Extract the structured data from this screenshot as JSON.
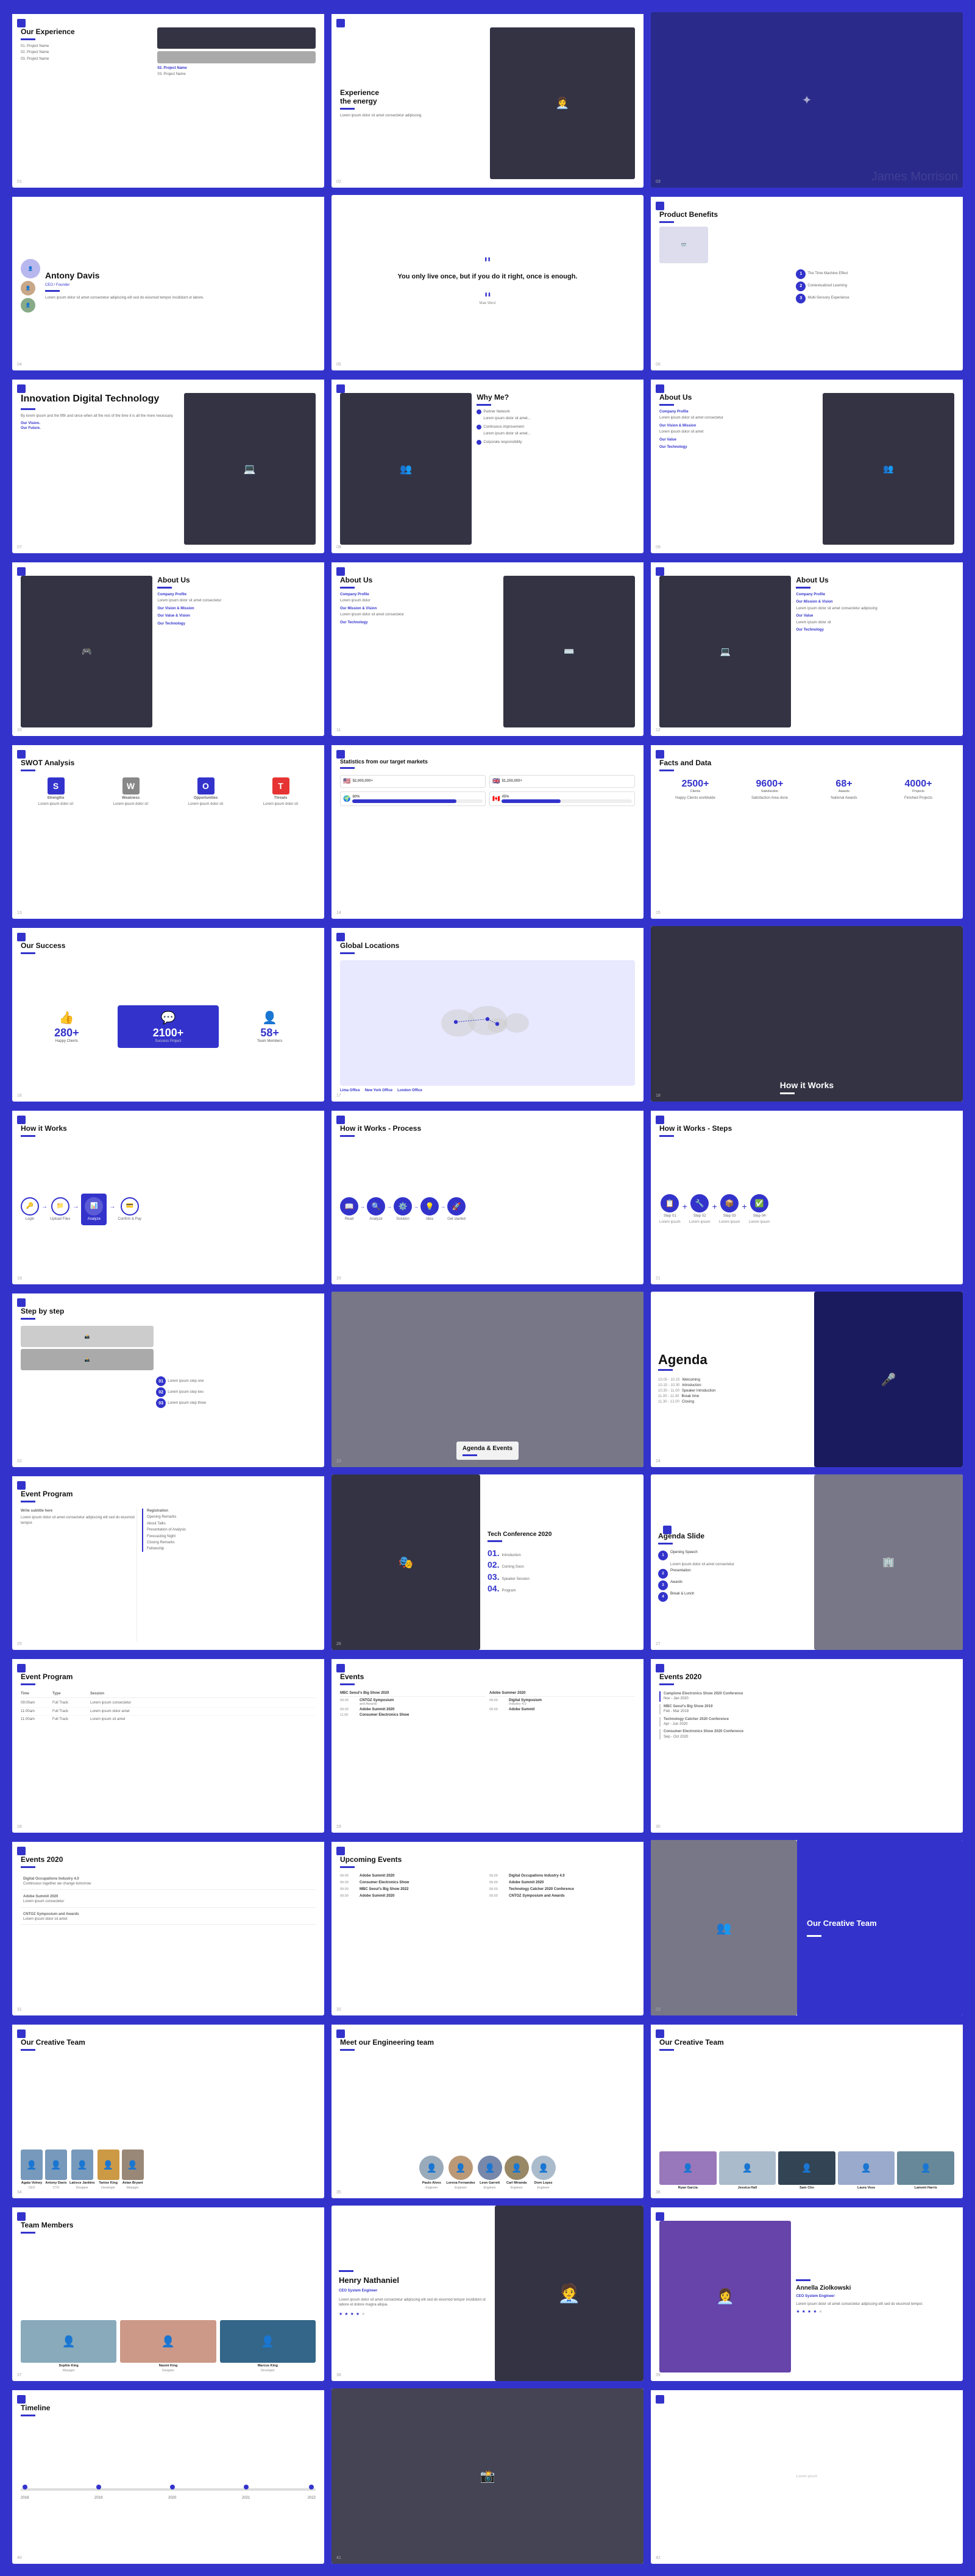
{
  "slides": [
    {
      "id": 1,
      "type": "experience",
      "title": "Our Experience",
      "subtitle": "01. Project Name",
      "items": [
        "02. Project Name",
        "03. Project Name"
      ],
      "number": "01"
    },
    {
      "id": 2,
      "type": "experience2",
      "title": "Experience the energy",
      "number": "02"
    },
    {
      "id": 3,
      "type": "dark-solid",
      "title": "",
      "number": "03"
    },
    {
      "id": 4,
      "type": "team-member",
      "name": "Antony Davis",
      "role": "CEO / Founder",
      "number": "04"
    },
    {
      "id": 5,
      "type": "quote",
      "quote": "You only live once, but if you do it right, once is enough.",
      "author": "Mae West",
      "number": "05"
    },
    {
      "id": 6,
      "type": "product-benefits",
      "title": "Product Benefits",
      "benefits": [
        "The Time Machine Effect",
        "Contextualized Learning",
        "Multi-Sensory Experience"
      ],
      "number": "06"
    },
    {
      "id": 7,
      "type": "innovation",
      "title": "Innovation Digital Technology",
      "body": "By lorem ipsum and the fifth and since when all the rest of the time it is all the more necessary to be done. Our Vision. Our Future.",
      "number": "07"
    },
    {
      "id": 8,
      "type": "why-me",
      "title": "Why Me?",
      "items": [
        "Partner Network",
        "Continuous improvement",
        "Corporate responsibility"
      ],
      "number": "08"
    },
    {
      "id": 9,
      "type": "about-us-right-photo",
      "title": "About Us",
      "sections": [
        "Company Profile",
        "Our Vision & Mission",
        "Our Value",
        "Our Technology"
      ],
      "number": "09"
    },
    {
      "id": 10,
      "type": "about-us-left-photo",
      "title": "About Us",
      "sections": [
        "Company Profile",
        "Our Vision & Mission",
        "Our Value & Vision",
        "Our Technology"
      ],
      "number": "10"
    },
    {
      "id": 11,
      "type": "about-us-dark-photo",
      "title": "About Us",
      "sections": [
        "Company Profile",
        "Our Mission & Vision",
        "Our Technology"
      ],
      "number": "11"
    },
    {
      "id": 12,
      "type": "about-us-dark-photo2",
      "title": "About Us",
      "sections": [
        "Company Profile",
        "Our Mission & Vision",
        "Our Value",
        "Our Technology"
      ],
      "number": "12"
    },
    {
      "id": 13,
      "type": "swot",
      "title": "SWOT Analysis",
      "items": [
        {
          "letter": "S",
          "label": "Strengths",
          "color": "#3333cc"
        },
        {
          "letter": "W",
          "label": "Weakness",
          "color": "#666"
        },
        {
          "letter": "O",
          "label": "Opportunities",
          "color": "#3333cc"
        },
        {
          "letter": "T",
          "label": "Threats",
          "color": "#e63333"
        }
      ],
      "number": "13"
    },
    {
      "id": 14,
      "type": "statistics",
      "title": "Statistics from our target markets",
      "stats": [
        {
          "flag": "🇺🇸",
          "value": "$2,000,000+",
          "label": ""
        },
        {
          "flag": "🇬🇧",
          "value": "$1,250,000+",
          "label": ""
        },
        {
          "flag": "🌍",
          "value": "80%",
          "label": ""
        },
        {
          "flag": "🇨🇦",
          "value": "45%",
          "label": ""
        }
      ],
      "number": "14"
    },
    {
      "id": 15,
      "type": "facts",
      "title": "Facts and Data",
      "stats": [
        {
          "value": "2500+",
          "label": ""
        },
        {
          "value": "9600+",
          "label": "Satisfaction Area"
        },
        {
          "value": "68+",
          "label": ""
        },
        {
          "value": "4000+",
          "label": ""
        }
      ],
      "number": "15"
    },
    {
      "id": 16,
      "type": "our-success",
      "title": "Our Success",
      "stats": [
        {
          "value": "280+",
          "label": "Happy Clients",
          "icon": "👍"
        },
        {
          "value": "2100+",
          "label": "Success Project",
          "icon": "💬"
        },
        {
          "value": "58+",
          "label": "Team Members",
          "icon": "👤"
        }
      ],
      "number": "16"
    },
    {
      "id": 17,
      "type": "global-locations",
      "title": "Global Locations",
      "locations": [
        "Lima Office",
        "New York Office",
        "London Office"
      ],
      "number": "17"
    },
    {
      "id": 18,
      "type": "how-it-works-dark",
      "title": "How it Works",
      "number": "18"
    },
    {
      "id": 19,
      "type": "how-it-works-steps",
      "title": "How it Works",
      "steps": [
        "Login",
        "Upload Files",
        "Analyze",
        "Confirm & Pay"
      ],
      "number": "19"
    },
    {
      "id": 20,
      "type": "how-it-works-process",
      "title": "How it Works - Process",
      "steps": [
        "Read",
        "Analyze",
        "Solution",
        "Idea",
        "Get started"
      ],
      "number": "20"
    },
    {
      "id": 21,
      "type": "how-it-works-steps2",
      "title": "How it Works - Steps",
      "steps": [
        "Step 01",
        "Step 02",
        "Step 03",
        "Step 04"
      ],
      "number": "21"
    },
    {
      "id": 22,
      "type": "step-by-step",
      "title": "Step by step",
      "number": "22"
    },
    {
      "id": 23,
      "type": "agenda-events-photo",
      "title": "Agenda & Events",
      "number": "23"
    },
    {
      "id": 24,
      "type": "agenda-dark",
      "title": "Agenda",
      "items": [
        {
          "time": "10.00 - 10.15",
          "label": "Welcoming"
        },
        {
          "time": "10.15 - 10.30",
          "label": "Introduction"
        },
        {
          "time": "10.30 - 11.00",
          "label": "Speaker Introduction"
        },
        {
          "time": "11.00 - 11.30",
          "label": "Break time"
        },
        {
          "time": "11.30 - 12.00",
          "label": "Closing"
        }
      ],
      "number": "24"
    },
    {
      "id": 25,
      "type": "event-program",
      "title": "Event Program",
      "items": [
        {
          "time": "",
          "label": "Registration"
        },
        {
          "time": "",
          "label": "Opening Remarks"
        },
        {
          "time": "",
          "label": "About Talks"
        },
        {
          "time": "",
          "label": "Presentation of Analysis"
        },
        {
          "time": "",
          "label": "Forecasting Night"
        },
        {
          "time": "",
          "label": "Closing Remarks"
        },
        {
          "time": "",
          "label": "Fellowship"
        }
      ],
      "number": "25"
    },
    {
      "id": 26,
      "type": "tech-conference",
      "title": "Tech Conference 2020",
      "items": [
        {
          "num": "01.",
          "label": "Introduction"
        },
        {
          "num": "02.",
          "label": "Coming Soon"
        },
        {
          "num": "03.",
          "label": "Speaker Session"
        },
        {
          "num": "04.",
          "label": ""
        }
      ],
      "number": "26"
    },
    {
      "id": 27,
      "type": "agenda-slide",
      "title": "Agenda Slide",
      "items": [
        {
          "label": "Opening Speech"
        },
        {
          "label": ""
        },
        {
          "label": ""
        },
        {
          "label": "Break & Lunch"
        }
      ],
      "number": "27"
    },
    {
      "id": 28,
      "type": "event-program2",
      "title": "Event Program",
      "rows": [
        {
          "time": "09:00am",
          "type": "Full Track",
          "session": ""
        },
        {
          "time": "11:00am",
          "type": "Full Track",
          "session": ""
        },
        {
          "time": "11:00am",
          "type": "Full Track",
          "session": ""
        }
      ],
      "number": "28"
    },
    {
      "id": 29,
      "type": "events-columns",
      "title": "Events",
      "columns": [
        {
          "header": "MBC Seoul's Big Show 2020",
          "events": [
            {
              "time": "09.00",
              "name": "CNTOZ Symposium and Awards"
            },
            {
              "time": "09.00",
              "name": "Adobe Summit 2020"
            },
            {
              "time": "11.00",
              "name": "Consumer Electronics Show"
            }
          ]
        },
        {
          "header": "Adobe Summer 2020",
          "events": [
            {
              "time": "09.00",
              "name": "Digital Symposium Industry 4.0"
            },
            {
              "time": "09.00",
              "name": ""
            }
          ]
        }
      ],
      "number": "29"
    },
    {
      "id": 30,
      "type": "events-2020",
      "title": "Events 2020",
      "items": [
        "Campione Electronics Show 2020 Conference",
        "MBC Seoul's Big Show 2019",
        "Technology Catcher 2020 Conference",
        "Consumer Electronics Show 2020 Conference"
      ],
      "number": "30"
    },
    {
      "id": 31,
      "type": "events-2020-list",
      "title": "Events 2020",
      "items": [
        "Digital Occupations Industry 4.0",
        "Continuous together we change tomorrow",
        "Adobe Summit 2020",
        "CNTOZ Symposium and Awards"
      ],
      "number": "31"
    },
    {
      "id": 32,
      "type": "upcoming-events",
      "title": "Upcoming Events",
      "leftCol": [
        {
          "time": "09.00",
          "name": "Adobe Summit 2020"
        },
        {
          "time": "09.00",
          "name": "Consumer Electronics Show"
        },
        {
          "time": "09.00",
          "name": "MBC Seoul's Big Show 2022"
        },
        {
          "time": "09.00",
          "name": "Adobe Summit 2020"
        }
      ],
      "rightCol": [
        {
          "time": "09.00",
          "name": "Digital Occupations Industry 4.0"
        },
        {
          "time": "09.00",
          "name": "Adobe Summit 2020"
        },
        {
          "time": "09.00",
          "name": "Technology Catcher 2020 Conference"
        },
        {
          "time": "09.00",
          "name": "CNTOZ Symposium and Awards"
        }
      ],
      "number": "32"
    },
    {
      "id": 33,
      "type": "creative-team-dark",
      "title": "Our Creative Team",
      "number": "33"
    },
    {
      "id": 34,
      "type": "our-creative-team",
      "title": "Our Creative Team",
      "members": [
        {
          "name": "Agata Volney",
          "role": "CEO"
        },
        {
          "name": "Antony Davis",
          "role": "CTO"
        },
        {
          "name": "Latrece Jankins",
          "role": "Designer"
        },
        {
          "name": "Tanise King",
          "role": "Developer"
        },
        {
          "name": "Avian Bryant",
          "role": "Manager"
        }
      ],
      "number": "34"
    },
    {
      "id": 35,
      "type": "meet-engineering",
      "title": "Meet our Engineering team",
      "members": [
        {
          "name": "Paulo Alves",
          "role": ""
        },
        {
          "name": "Lorena Fernandez",
          "role": ""
        },
        {
          "name": "Leon Garrett",
          "role": ""
        },
        {
          "name": "Carl Miranda",
          "role": ""
        },
        {
          "name": "Dom Lopez",
          "role": ""
        }
      ],
      "number": "35"
    },
    {
      "id": 36,
      "type": "our-creative-team2",
      "title": "Our Creative Team",
      "members": [
        {
          "name": "Ryan Garcia",
          "role": ""
        },
        {
          "name": "Jessica Hall",
          "role": ""
        },
        {
          "name": "Sam Cho",
          "role": ""
        },
        {
          "name": "Laura Voss",
          "role": ""
        },
        {
          "name": "Lamont Harris",
          "role": ""
        }
      ],
      "number": "36"
    },
    {
      "id": 37,
      "type": "team-members",
      "title": "Team Members",
      "members": [
        {
          "name": "Sophie King",
          "role": ""
        },
        {
          "name": "Naomi King",
          "role": ""
        },
        {
          "name": "Marcus King",
          "role": ""
        }
      ],
      "number": "37"
    },
    {
      "id": 38,
      "type": "henry",
      "title": "Henry Nathaniel",
      "role": "CEO System Engineer",
      "number": "38"
    },
    {
      "id": 39,
      "type": "annella",
      "title": "Annella Ziolkowski",
      "role": "CEO System Engineer",
      "number": "39"
    },
    {
      "id": 40,
      "type": "timeline-preview",
      "title": "Timeline",
      "number": "40"
    },
    {
      "id": 41,
      "type": "blank",
      "number": "41"
    },
    {
      "id": 42,
      "type": "blank2",
      "number": "42"
    }
  ],
  "colors": {
    "primary": "#3333cc",
    "dark": "#1a1a6e",
    "white": "#ffffff",
    "gray": "#888888",
    "red": "#e63333",
    "light": "#f5f5ff"
  }
}
